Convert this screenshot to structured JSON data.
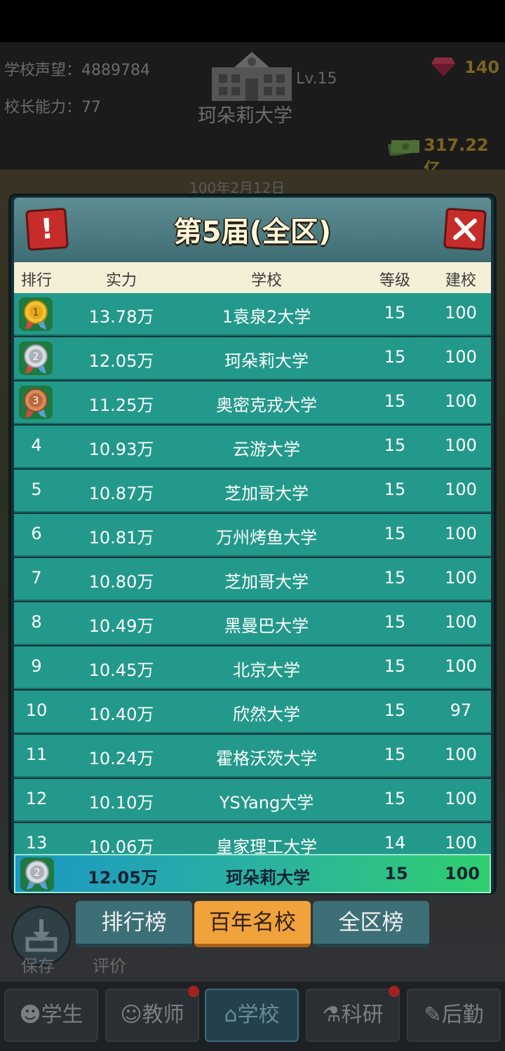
{
  "header": {
    "reputation_label": "学校声望：",
    "reputation_value": "4889784",
    "ability_label": "校长能力：",
    "ability_value": "77",
    "level": "Lv.15",
    "school_name": "珂朵莉大学",
    "gems": "140",
    "money": "317.22亿",
    "date": "100年2月12日"
  },
  "modal": {
    "title": "第5届(全区)",
    "alert_glyph": "!",
    "columns": [
      "排行",
      "实力",
      "学校",
      "等级",
      "建校"
    ],
    "rows": [
      {
        "rank": "1",
        "power": "13.78万",
        "school": "1袁泉2大学",
        "level": "15",
        "founded": "100",
        "medal": "gold"
      },
      {
        "rank": "2",
        "power": "12.05万",
        "school": "珂朵莉大学",
        "level": "15",
        "founded": "100",
        "medal": "silver"
      },
      {
        "rank": "3",
        "power": "11.25万",
        "school": "奥密克戎大学",
        "level": "15",
        "founded": "100",
        "medal": "bronze"
      },
      {
        "rank": "4",
        "power": "10.93万",
        "school": "云游大学",
        "level": "15",
        "founded": "100"
      },
      {
        "rank": "5",
        "power": "10.87万",
        "school": "芝加哥大学",
        "level": "15",
        "founded": "100"
      },
      {
        "rank": "6",
        "power": "10.81万",
        "school": "万州烤鱼大学",
        "level": "15",
        "founded": "100"
      },
      {
        "rank": "7",
        "power": "10.80万",
        "school": "芝加哥大学",
        "level": "15",
        "founded": "100"
      },
      {
        "rank": "8",
        "power": "10.49万",
        "school": "黑曼巴大学",
        "level": "15",
        "founded": "100"
      },
      {
        "rank": "9",
        "power": "10.45万",
        "school": "北京大学",
        "level": "15",
        "founded": "100"
      },
      {
        "rank": "10",
        "power": "10.40万",
        "school": "欣然大学",
        "level": "15",
        "founded": "97"
      },
      {
        "rank": "11",
        "power": "10.24万",
        "school": "霍格沃茨大学",
        "level": "15",
        "founded": "100"
      },
      {
        "rank": "12",
        "power": "10.10万",
        "school": "YSYang大学",
        "level": "15",
        "founded": "100"
      },
      {
        "rank": "13",
        "power": "10.06万",
        "school": "皇家理工大学",
        "level": "14",
        "founded": "100"
      }
    ],
    "self": {
      "rank": "2",
      "power": "12.05万",
      "school": "珂朵莉大学",
      "level": "15",
      "founded": "100",
      "medal": "silver"
    }
  },
  "tabs": [
    {
      "label": "排行榜",
      "active": false
    },
    {
      "label": "百年名校",
      "active": true
    },
    {
      "label": "全区榜",
      "active": false
    }
  ],
  "side_buttons": {
    "save": "保存",
    "rate": "评价"
  },
  "nav": [
    {
      "label": "学生",
      "icon": "student-icon"
    },
    {
      "label": "教师",
      "icon": "teacher-icon"
    },
    {
      "label": "学校",
      "icon": "school-icon",
      "active": true
    },
    {
      "label": "科研",
      "icon": "flask-icon"
    },
    {
      "label": "后勤",
      "icon": "clipboard-icon"
    }
  ],
  "colors": {
    "row": "#23998b",
    "header": "#f6efd8",
    "active_tab": "#f0a23b",
    "close": "#c62d2a"
  }
}
